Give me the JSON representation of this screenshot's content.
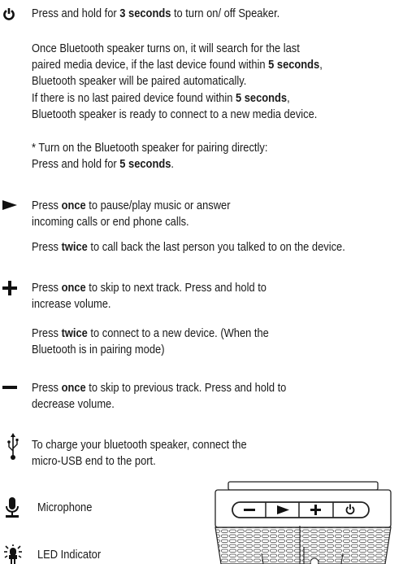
{
  "power": {
    "line1_pre": "Press and hold for ",
    "line1_bold": "3 seconds",
    "line1_post": " to turn on/ off Speaker.",
    "p2_l1": "Once Bluetooth speaker turns on, it will search for the last",
    "p2_l2_pre": "paired media device, if the last device found within ",
    "p2_l2_bold": "5 seconds",
    "p2_l2_post": ",",
    "p2_l3": "Bluetooth speaker will be paired automatically.",
    "p2_l4_pre": "If there is no last paired device found within ",
    "p2_l4_bold": "5 seconds",
    "p2_l4_post": ",",
    "p2_l5": "Bluetooth speaker is ready to connect to a new media device.",
    "note_l1": "* Turn on the Bluetooth speaker for pairing directly:",
    "note_l2_pre": "Press and hold for ",
    "note_l2_bold": "5 seconds",
    "note_l2_post": "."
  },
  "play": {
    "l1_pre": "Press ",
    "l1_bold": "once",
    "l1_post": " to pause/play music or answer",
    "l2": "incoming calls or end phone calls.",
    "l3_pre": "Press ",
    "l3_bold": "twice",
    "l3_post": " to call back the last person you talked to on the device."
  },
  "plus": {
    "l1_pre": "Press ",
    "l1_bold": "once",
    "l1_post": " to skip to next track. Press and hold to",
    "l2": "increase volume.",
    "l3_pre": "Press ",
    "l3_bold": "twice",
    "l3_post": " to connect to a new device. (When the",
    "l4": "Bluetooth is in pairing mode)"
  },
  "minus": {
    "l1_pre": "Press ",
    "l1_bold": "once",
    "l1_post": " to skip to previous track. Press and hold to",
    "l2": "decrease volume."
  },
  "usb": {
    "l1": "To charge your bluetooth speaker, connect the",
    "l2": "micro-USB end to the port."
  },
  "microphone": {
    "label": "Microphone"
  },
  "led": {
    "label": "LED Indicator"
  },
  "icons": [
    "power-icon",
    "play-icon",
    "plus-icon",
    "minus-icon",
    "usb-icon",
    "microphone-icon",
    "led-icon"
  ],
  "device_buttons": [
    "minus-button",
    "play-button",
    "plus-button",
    "power-button"
  ]
}
